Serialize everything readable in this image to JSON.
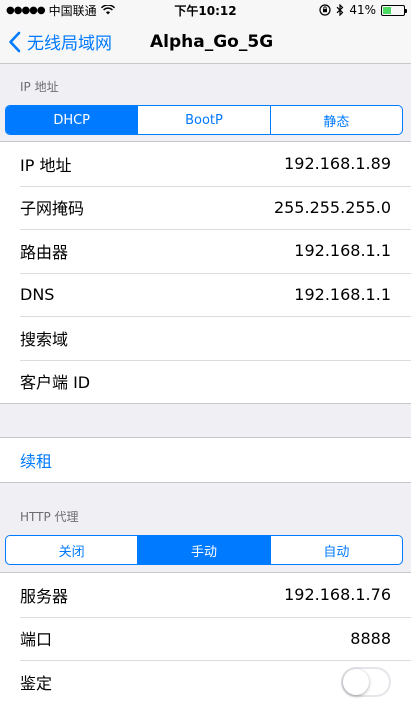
{
  "status_bar": {
    "signal": "●●●●●",
    "carrier": "中国联通",
    "time": "下午10:12",
    "battery": "41%",
    "battery_level": 0.41,
    "battery_color": "#4cd964"
  },
  "nav": {
    "back_label": "无线局域网",
    "title": "Alpha_Go_5G",
    "tint_color": "#007aff"
  },
  "ip_section": {
    "header": "IP 地址",
    "modes": [
      {
        "label": "DHCP",
        "selected": true
      },
      {
        "label": "BootP",
        "selected": false
      },
      {
        "label": "静态",
        "selected": false
      }
    ],
    "rows": [
      {
        "label": "IP 地址",
        "value": "192.168.1.89"
      },
      {
        "label": "子网掩码",
        "value": "255.255.255.0"
      },
      {
        "label": "路由器",
        "value": "192.168.1.1"
      },
      {
        "label": "DNS",
        "value": "192.168.1.1"
      },
      {
        "label": "搜索域",
        "value": ""
      },
      {
        "label": "客户端 ID",
        "value": ""
      }
    ]
  },
  "renew": {
    "label": "续租"
  },
  "proxy_section": {
    "header": "HTTP 代理",
    "modes": [
      {
        "label": "关闭",
        "selected": false
      },
      {
        "label": "手动",
        "selected": true
      },
      {
        "label": "自动",
        "selected": false
      }
    ],
    "rows": [
      {
        "label": "服务器",
        "value": "192.168.1.76"
      },
      {
        "label": "端口",
        "value": "8888"
      }
    ],
    "auth": {
      "label": "鉴定",
      "enabled": false
    }
  }
}
